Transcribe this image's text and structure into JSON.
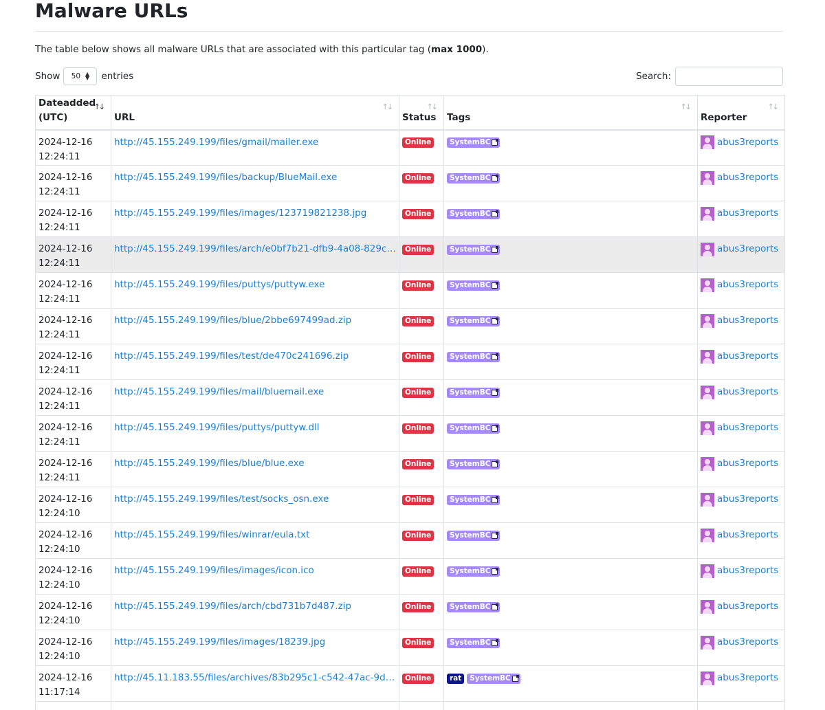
{
  "page": {
    "title": "Malware URLs",
    "intro_prefix": "The table below shows all malware URLs that are associated with this particular tag (",
    "intro_bold": "max 1000",
    "intro_suffix": ")."
  },
  "controls": {
    "show_label": "Show",
    "page_length": "50",
    "entries_label": "entries",
    "search_label": "Search:",
    "search_value": ""
  },
  "colors": {
    "link": "#1a7fd9",
    "online_badge": "#dc3545",
    "tag_badge": "#a58bf1",
    "rat_badge": "#0d1685",
    "avatar": "#b45fcb"
  },
  "table": {
    "headers": {
      "date": "Dateadded (UTC)",
      "url": "URL",
      "status": "Status",
      "tags": "Tags",
      "reporter": "Reporter"
    },
    "sorted_column": "date",
    "sort_direction": "descending",
    "rows": [
      {
        "date": "2024-12-16\n12:24:11",
        "url": "http://45.155.249.199/files/gmail/mailer.exe",
        "status": "Online",
        "tags": [
          "SystemBC"
        ],
        "reporter": "abus3reports"
      },
      {
        "date": "2024-12-16\n12:24:11",
        "url": "http://45.155.249.199/files/backup/BlueMail.exe",
        "status": "Online",
        "tags": [
          "SystemBC"
        ],
        "reporter": "abus3reports"
      },
      {
        "date": "2024-12-16\n12:24:11",
        "url": "http://45.155.249.199/files/images/123719821238.jpg",
        "status": "Online",
        "tags": [
          "SystemBC"
        ],
        "reporter": "abus3reports"
      },
      {
        "date": "2024-12-16\n12:24:11",
        "url": "http://45.155.249.199/files/arch/e0bf7b21-dfb9-4a08-829c-...",
        "status": "Online",
        "tags": [
          "SystemBC"
        ],
        "reporter": "abus3reports",
        "hover": true
      },
      {
        "date": "2024-12-16\n12:24:11",
        "url": "http://45.155.249.199/files/puttys/puttyw.exe",
        "status": "Online",
        "tags": [
          "SystemBC"
        ],
        "reporter": "abus3reports"
      },
      {
        "date": "2024-12-16\n12:24:11",
        "url": "http://45.155.249.199/files/blue/2bbe697499ad.zip",
        "status": "Online",
        "tags": [
          "SystemBC"
        ],
        "reporter": "abus3reports"
      },
      {
        "date": "2024-12-16\n12:24:11",
        "url": "http://45.155.249.199/files/test/de470c241696.zip",
        "status": "Online",
        "tags": [
          "SystemBC"
        ],
        "reporter": "abus3reports"
      },
      {
        "date": "2024-12-16\n12:24:11",
        "url": "http://45.155.249.199/files/mail/bluemail.exe",
        "status": "Online",
        "tags": [
          "SystemBC"
        ],
        "reporter": "abus3reports"
      },
      {
        "date": "2024-12-16\n12:24:11",
        "url": "http://45.155.249.199/files/puttys/puttyw.dll",
        "status": "Online",
        "tags": [
          "SystemBC"
        ],
        "reporter": "abus3reports"
      },
      {
        "date": "2024-12-16\n12:24:11",
        "url": "http://45.155.249.199/files/blue/blue.exe",
        "status": "Online",
        "tags": [
          "SystemBC"
        ],
        "reporter": "abus3reports"
      },
      {
        "date": "2024-12-16\n12:24:10",
        "url": "http://45.155.249.199/files/test/socks_osn.exe",
        "status": "Online",
        "tags": [
          "SystemBC"
        ],
        "reporter": "abus3reports"
      },
      {
        "date": "2024-12-16\n12:24:10",
        "url": "http://45.155.249.199/files/winrar/eula.txt",
        "status": "Online",
        "tags": [
          "SystemBC"
        ],
        "reporter": "abus3reports"
      },
      {
        "date": "2024-12-16\n12:24:10",
        "url": "http://45.155.249.199/files/images/icon.ico",
        "status": "Online",
        "tags": [
          "SystemBC"
        ],
        "reporter": "abus3reports"
      },
      {
        "date": "2024-12-16\n12:24:10",
        "url": "http://45.155.249.199/files/arch/cbd731b7d487.zip",
        "status": "Online",
        "tags": [
          "SystemBC"
        ],
        "reporter": "abus3reports"
      },
      {
        "date": "2024-12-16\n12:24:10",
        "url": "http://45.155.249.199/files/images/18239.jpg",
        "status": "Online",
        "tags": [
          "SystemBC"
        ],
        "reporter": "abus3reports"
      },
      {
        "date": "2024-12-16\n11:17:14",
        "url": "http://45.11.183.55/files/archives/83b295c1-c542-47ac-9dc...",
        "status": "Online",
        "tags": [
          "rat",
          "SystemBC"
        ],
        "reporter": "abus3reports"
      },
      {
        "date": "",
        "url": "",
        "status": "",
        "tags": [],
        "reporter": ""
      }
    ]
  }
}
